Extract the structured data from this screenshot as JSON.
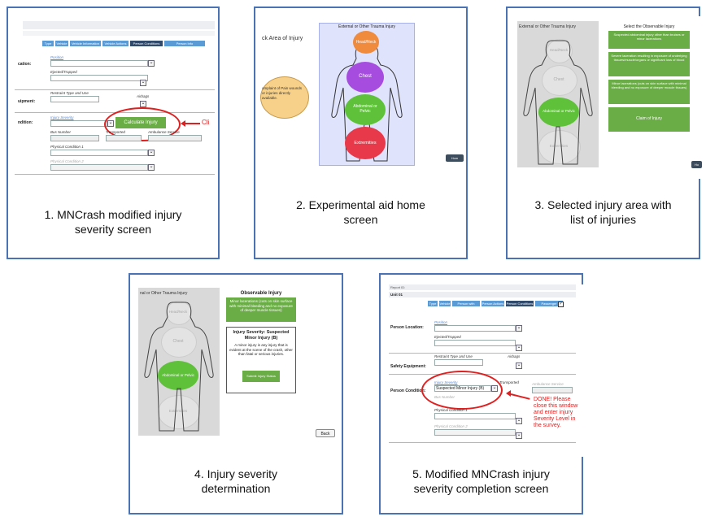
{
  "panels": [
    {
      "caption_lines": [
        "1. MNCrash modified injury",
        "severity screen"
      ],
      "tabs": [
        "Type",
        "Vehicle",
        "Vehicle Information",
        "Vehicle Actions",
        "Person Conditions",
        "Person Info"
      ],
      "labels": [
        "cation:",
        "uipment:",
        "ndition:"
      ],
      "fields": [
        "Position",
        "Ejected/Trapped",
        "Restraint Type and Use",
        "Airbags",
        "Injury Severity",
        "Bus Number",
        "Transported",
        "Ambulance Service",
        "Physical Condition 1",
        "Physical Condition 2"
      ],
      "button": "Calculate Injury",
      "callout": "Cli"
    },
    {
      "caption_lines": [
        "2. Experimental aid home",
        "screen"
      ],
      "title": "External or Other Trauma Injury",
      "side_text": "ck Area of Injury",
      "complaint": "omplaint of Pain wounds or injuries directly available.",
      "regions": [
        "Head/Neck",
        "Chest",
        "Abdominal or Pelvic",
        "Extremities"
      ],
      "home_btn": "Hom"
    },
    {
      "caption_lines": [
        "3. Selected injury area with",
        "list of injuries"
      ],
      "title": "External or Other Trauma Injury",
      "list_title": "Select the Observable Injury",
      "regions": [
        "Head/Neck",
        "Chest",
        "Abdominal or Pelvic",
        "Extremities"
      ],
      "options": [
        "Suspected abdominal injury other than bruises or minor lacerations",
        "Severe laceration resulting in exposure of underlying tissues/muscle/organs or significant loss of blood",
        "Minor lacerations (cuts on skin surface with minimal bleeding and no exposure of deeper muscle tissues)",
        "Claim of Injury"
      ],
      "home_btn": "Ho"
    },
    {
      "caption_lines": [
        "4. Injury severity",
        "determination"
      ],
      "title": "nal or Other Trauma Injury",
      "obs_title": "Observable Injury",
      "obs_text": "Minor lacerations (cuts on skin surface with minimal bleeding and no exposure of deeper muscle tissues)",
      "sev_title": "Injury Severity: Suspected Minor Injury (B)",
      "sev_text": "A minor injury is any injury that is evident at the scene of the crash, other than fatal or serious injuries.",
      "submit": "Submit Injury Status",
      "regions": [
        "Head/Neck",
        "Chest",
        "Abdominal or Pelvic",
        "Extremities"
      ],
      "back_btn": "Back"
    },
    {
      "caption_lines": [
        "5. Modified MNCrash injury",
        "severity completion screen"
      ],
      "report": "Report ID:",
      "unit": "Unit 01",
      "tabs": [
        "Type",
        "Vehicle",
        "Person with Vehicle",
        "Person Actions",
        "Person Conditions",
        "Passenger"
      ],
      "labels": [
        "Person Location:",
        "Safety Equipment:",
        "Person Condition:"
      ],
      "fields": [
        "Position",
        "Ejected/Trapped",
        "Restraint Type and Use",
        "Airbags",
        "Injury Severity",
        "Transported",
        "Ambulance Service",
        "Bus Number",
        "Physical Condition 1",
        "Physical Condition 2"
      ],
      "selected": "Suspected Minor Injury (B)",
      "done_text": "DONE! Please close this window and enter injury Severity Level in the survey."
    }
  ],
  "colors": {
    "frame": "#4a72b5",
    "green": "#6aac45",
    "red": "#e02020",
    "orange": "#f08a3c",
    "purple": "#a64de0",
    "region_green": "#5fc13a",
    "region_red": "#e8394a"
  }
}
